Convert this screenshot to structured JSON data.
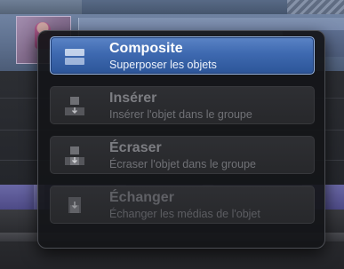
{
  "menu": {
    "items": [
      {
        "title": "Composite",
        "subtitle": "Superposer les objets",
        "icon": "composite-icon",
        "state": "selected"
      },
      {
        "title": "Insérer",
        "subtitle": "Insérer l'objet dans le groupe",
        "icon": "insert-icon",
        "state": "normal"
      },
      {
        "title": "Écraser",
        "subtitle": "Écraser l'objet dans le groupe",
        "icon": "overwrite-icon",
        "state": "normal"
      },
      {
        "title": "Échanger",
        "subtitle": "Échanger les médias de l'objet",
        "icon": "exchange-icon",
        "state": "disabled"
      }
    ]
  },
  "colors": {
    "selected_item": "#3e69b0",
    "popup_background": "#141518",
    "item_background": "#2b2c30"
  },
  "drag": {
    "thumbnail": "media-thumbnail",
    "cursor": "drag-cursor-icon"
  }
}
